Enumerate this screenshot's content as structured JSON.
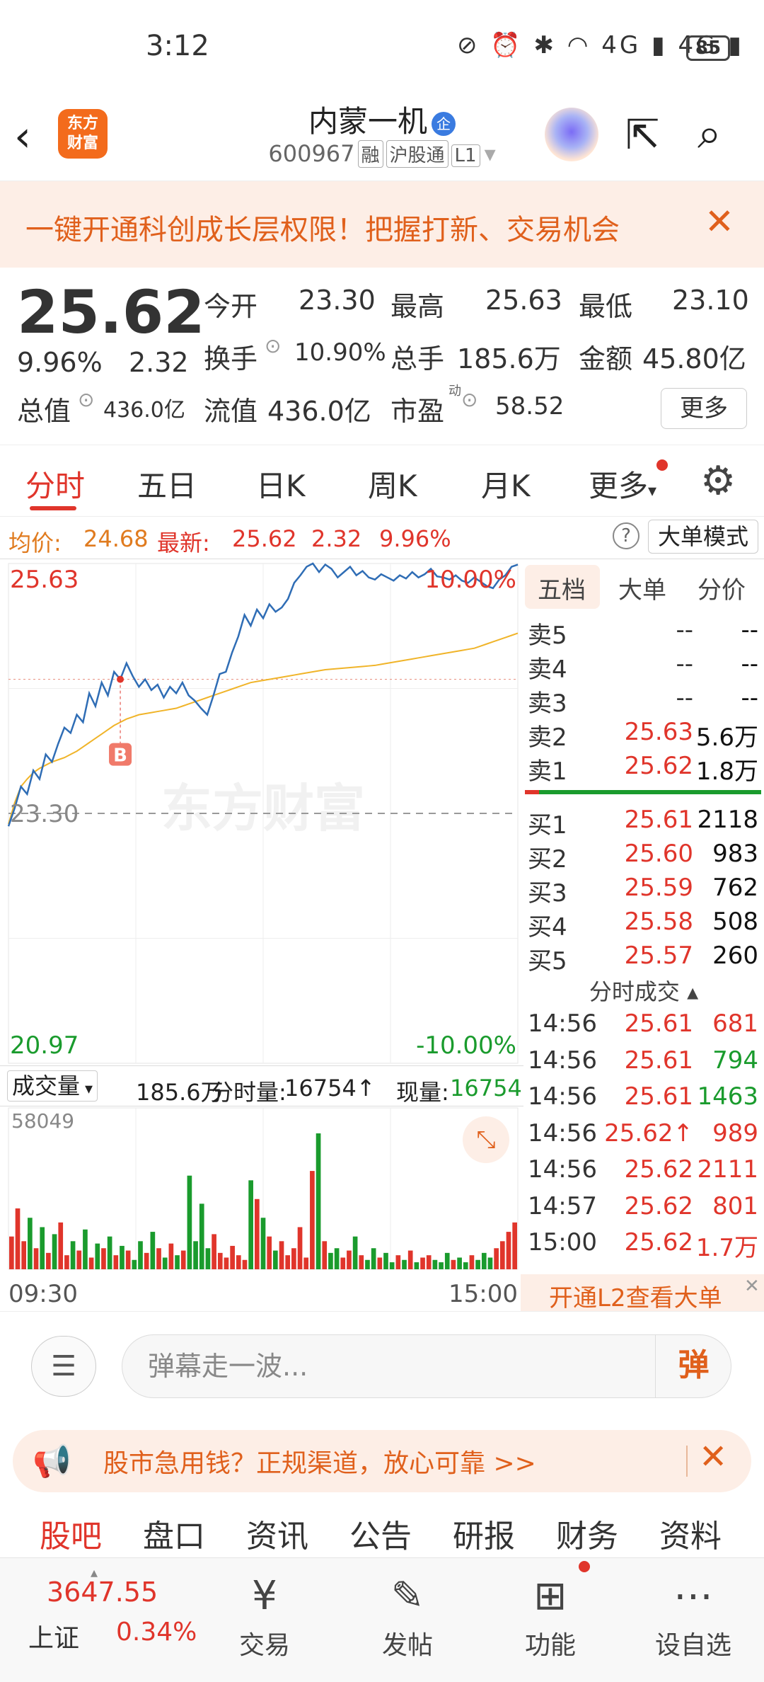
{
  "status_bar": {
    "time": "3:12",
    "icons": "⊘ ⏰ ✱ ◠ 4G ▮ 4G ▮",
    "battery": "85"
  },
  "header": {
    "title": "内蒙一机",
    "badge": "企",
    "code": "600967",
    "tags": [
      "融",
      "沪股通",
      "L1"
    ],
    "logo": "东方 财富"
  },
  "promo": {
    "text": "一键开通科创成长层权限！把握打新、交易机会"
  },
  "quote": {
    "price": "25.62",
    "pct": "9.96%",
    "change": "2.32",
    "open_label": "今开",
    "open": "23.30",
    "high_label": "最高",
    "high": "25.63",
    "low_label": "最低",
    "low": "23.10",
    "turnover_label": "换手",
    "turnover": "10.90%",
    "volume_label": "总手",
    "volume": "185.6万",
    "amount_label": "金额",
    "amount": "45.80亿",
    "mcap_label": "总值",
    "mcap": "436.0亿",
    "float_label": "流值",
    "float": "436.0亿",
    "pe_label": "市盈",
    "pe_sup": "动",
    "pe": "58.52",
    "more": "更多"
  },
  "tabs": [
    "分时",
    "五日",
    "日K",
    "周K",
    "月K",
    "更多"
  ],
  "infobar": {
    "avg_label": "均价:",
    "avg": "24.68",
    "last_label": "最新:",
    "last": "25.62",
    "change": "2.32",
    "pct": "9.96%",
    "mode": "大单模式"
  },
  "chart_data": {
    "type": "line",
    "x_range": [
      "09:30",
      "15:00"
    ],
    "ylim": [
      20.97,
      25.63
    ],
    "prev_close": 23.3,
    "top_label": "25.63",
    "top_pct": "10.00%",
    "mid_label": "23.30",
    "bottom_label": "20.97",
    "bottom_pct": "-10.00%",
    "marker": "B",
    "watermark": "东方财富",
    "series": [
      {
        "name": "price",
        "values": [
          23.18,
          23.35,
          23.55,
          23.48,
          23.7,
          23.62,
          23.85,
          23.78,
          23.95,
          24.1,
          24.05,
          24.22,
          24.15,
          24.42,
          24.3,
          24.52,
          24.4,
          24.62,
          24.55,
          24.7,
          24.58,
          24.48,
          24.55,
          24.45,
          24.5,
          24.38,
          24.48,
          24.42,
          24.52,
          24.4,
          24.35,
          24.28,
          24.22,
          24.4,
          24.6,
          24.62,
          24.8,
          24.95,
          25.15,
          25.05,
          25.2,
          25.12,
          25.25,
          25.18,
          25.22,
          25.3,
          25.45,
          25.52,
          25.6,
          25.63,
          25.55,
          25.62,
          25.58,
          25.5,
          25.55,
          25.6,
          25.52,
          25.56,
          25.5,
          25.48,
          25.53,
          25.5,
          25.47,
          25.52,
          25.49,
          25.55,
          25.5,
          25.53,
          25.58,
          25.51,
          25.5,
          25.48,
          25.52,
          25.47,
          25.45,
          25.5,
          25.46,
          25.42,
          25.4,
          25.48,
          25.52,
          25.6,
          25.62
        ]
      },
      {
        "name": "avg",
        "values": [
          23.2,
          23.4,
          23.55,
          23.62,
          23.68,
          23.72,
          23.75,
          23.78,
          23.8,
          23.82,
          23.85,
          23.88,
          23.92,
          23.96,
          24.0,
          24.04,
          24.08,
          24.12,
          24.15,
          24.18,
          24.2,
          24.22,
          24.23,
          24.24,
          24.25,
          24.26,
          24.27,
          24.28,
          24.3,
          24.32,
          24.34,
          24.36,
          24.38,
          24.4,
          24.42,
          24.44,
          24.46,
          24.48,
          24.5,
          24.52,
          24.53,
          24.54,
          24.55,
          24.56,
          24.57,
          24.58,
          24.59,
          24.6,
          24.61,
          24.62,
          24.63,
          24.64,
          24.645,
          24.65,
          24.655,
          24.66,
          24.665,
          24.67,
          24.675,
          24.68,
          24.69,
          24.7,
          24.71,
          24.72,
          24.73,
          24.74,
          24.75,
          24.76,
          24.77,
          24.78,
          24.79,
          24.8,
          24.81,
          24.82,
          24.83,
          24.84,
          24.86,
          24.88,
          24.9,
          24.92,
          24.94,
          24.96,
          24.98
        ]
      }
    ],
    "volume": {
      "max_label": "58049",
      "max": 58049,
      "bars": [
        14000,
        26000,
        12000,
        22000,
        9000,
        18000,
        7000,
        15000,
        20000,
        6000,
        12000,
        8000,
        17000,
        5000,
        11000,
        9000,
        14000,
        6000,
        10000,
        8000,
        4000,
        12000,
        7000,
        16000,
        9000,
        5000,
        11000,
        6000,
        8000,
        40000,
        12000,
        28000,
        9000,
        15000,
        7000,
        5000,
        10000,
        6000,
        4000,
        38000,
        30000,
        22000,
        14000,
        8000,
        12000,
        6000,
        9000,
        18000,
        5000,
        42000,
        58049,
        12000,
        7000,
        9000,
        5000,
        8000,
        14000,
        6000,
        4000,
        9000,
        5000,
        7000,
        3000,
        6000,
        4000,
        8000,
        3000,
        5000,
        6000,
        4000,
        3000,
        7000,
        4000,
        5000,
        3000,
        6000,
        4000,
        7000,
        5000,
        9000,
        12000,
        16000,
        20000
      ]
    },
    "volume_header": {
      "label": "成交量",
      "total": "185.6万",
      "seg_label": "分时量:",
      "seg": "16754",
      "now_label": "现量:",
      "now": "16754"
    }
  },
  "orderbook": {
    "tabs": [
      "五档",
      "大单",
      "分价"
    ],
    "asks": [
      {
        "l": "卖5",
        "p": "--",
        "v": "--"
      },
      {
        "l": "卖4",
        "p": "--",
        "v": "--"
      },
      {
        "l": "卖3",
        "p": "--",
        "v": "--"
      },
      {
        "l": "卖2",
        "p": "25.63",
        "v": "5.6万"
      },
      {
        "l": "卖1",
        "p": "25.62",
        "v": "1.8万"
      }
    ],
    "bids": [
      {
        "l": "买1",
        "p": "25.61",
        "v": "2118"
      },
      {
        "l": "买2",
        "p": "25.60",
        "v": "983"
      },
      {
        "l": "买3",
        "p": "25.59",
        "v": "762"
      },
      {
        "l": "买4",
        "p": "25.58",
        "v": "508"
      },
      {
        "l": "买5",
        "p": "25.57",
        "v": "260"
      }
    ],
    "ticks_title": "分时成交",
    "ticks": [
      {
        "t": "14:56",
        "p": "25.61",
        "v": "681",
        "c": "red"
      },
      {
        "t": "14:56",
        "p": "25.61",
        "v": "794",
        "c": "green"
      },
      {
        "t": "14:56",
        "p": "25.61",
        "v": "1463",
        "c": "green"
      },
      {
        "t": "14:56",
        "p": "25.62↑",
        "v": "989",
        "c": "red"
      },
      {
        "t": "14:56",
        "p": "25.62",
        "v": "2111",
        "c": "red"
      },
      {
        "t": "14:57",
        "p": "25.62",
        "v": "801",
        "c": "red"
      },
      {
        "t": "15:00",
        "p": "25.62",
        "v": "1.7万",
        "c": "red"
      }
    ],
    "l2": "开通L2查看大单"
  },
  "danmu": {
    "placeholder": "弹幕走一波...",
    "send": "弹"
  },
  "ad": {
    "text": "股市急用钱？正规渠道，放心可靠 >>"
  },
  "bottom_tabs": [
    "股吧",
    "盘口",
    "资讯",
    "公告",
    "研报",
    "财务",
    "资料"
  ],
  "nav": {
    "index_name": "上证",
    "index_value": "3647.55",
    "index_pct": "0.34%",
    "items": [
      "交易",
      "发帖",
      "功能",
      "设自选"
    ]
  }
}
